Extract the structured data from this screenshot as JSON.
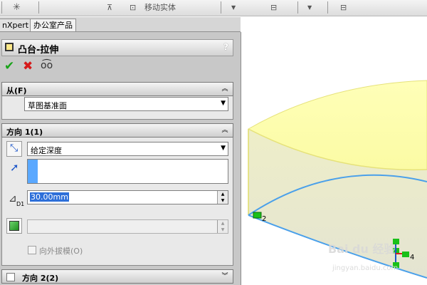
{
  "toolbar": {
    "move_entity": "移动实体"
  },
  "tabs": [
    {
      "label": "nXpert"
    },
    {
      "label": "办公室产品"
    }
  ],
  "feature": {
    "title": "凸台-拉伸",
    "help": "?"
  },
  "sections": {
    "from": {
      "title": "从(F)",
      "value": "草图基准面"
    },
    "dir1": {
      "title": "方向 1(1)",
      "end_condition": "给定深度",
      "depth": "30.00mm",
      "depth_sub": "D1",
      "draft_label": "向外拔模(O)"
    },
    "dir2": {
      "title": "方向 2(2)"
    }
  },
  "viewport": {
    "point_labels": [
      "2",
      "4"
    ],
    "watermark": "Bai du 经验",
    "watermark_sub": "jingyan.baidu.com"
  },
  "colors": {
    "accent": "#2f6fd6",
    "model_face": "#ffff99"
  }
}
